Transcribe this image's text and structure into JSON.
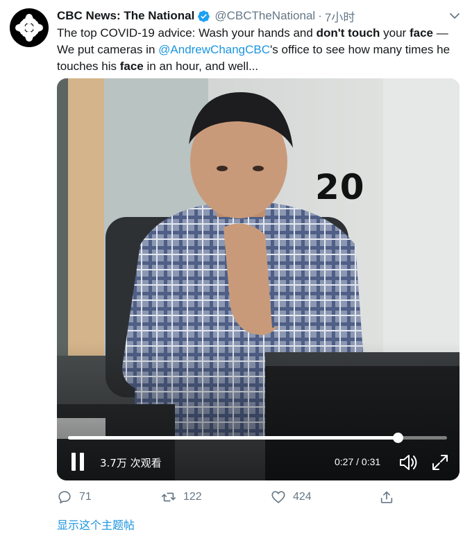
{
  "tweet": {
    "author_name": "CBC News: The National",
    "handle": "@CBCTheNational",
    "separator": "·",
    "time": "7小时",
    "text": {
      "p1": "The top COVID-19 advice: Wash your hands and ",
      "b1": "don't touch",
      "p2": " your ",
      "b2": "face",
      "p3": " — We put cameras in ",
      "mention": "@AndrewChangCBC",
      "p4": "'s office to see how many times he touches his ",
      "b3": "face",
      "p5": " in an hour, and well..."
    }
  },
  "video": {
    "overlay_count": "20",
    "progress": 0.87,
    "views": "3.7万 次观看",
    "timecode": "0:27 / 0:31"
  },
  "actions": {
    "replies": "71",
    "retweets": "122",
    "likes": "424"
  },
  "show_thread": "显示这个主题帖",
  "colors": {
    "accent": "#1b95e0",
    "muted": "#657786",
    "verified": "#1da1f2"
  },
  "icons": [
    "cbc-logo-icon",
    "verified-icon",
    "chevron-down-icon",
    "pause-icon",
    "volume-icon",
    "fullscreen-icon",
    "reply-icon",
    "retweet-icon",
    "like-icon",
    "share-icon"
  ]
}
